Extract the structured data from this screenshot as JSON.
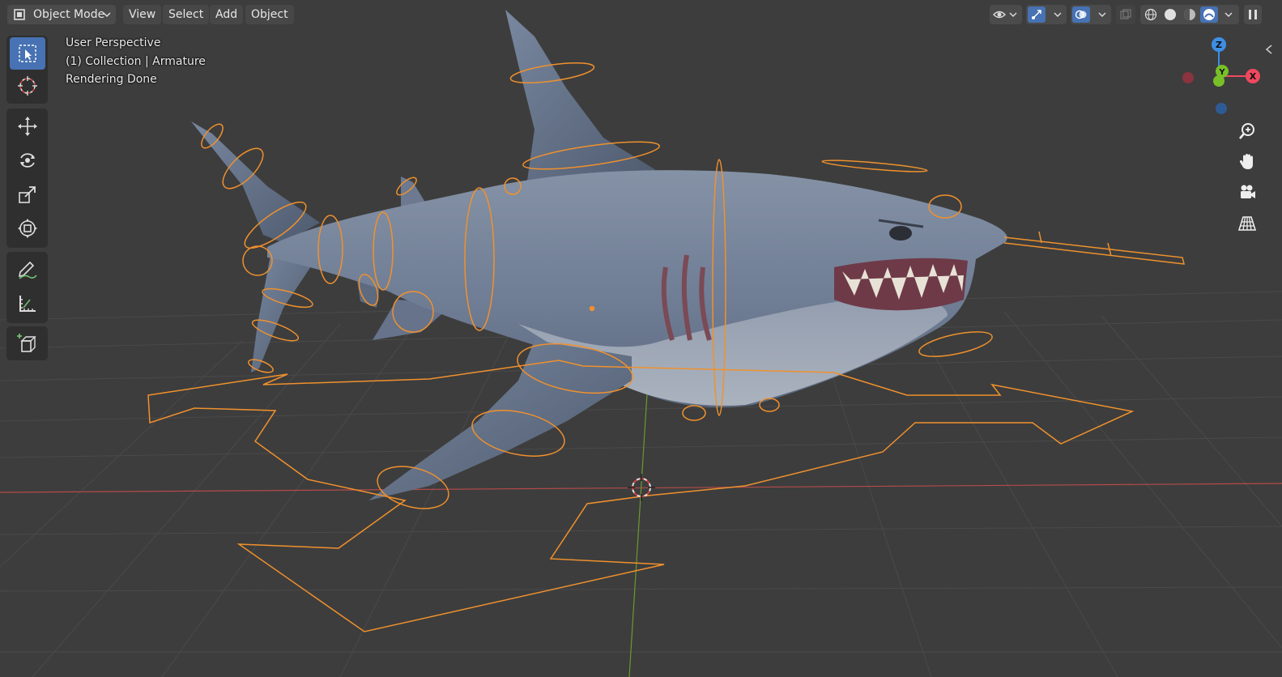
{
  "header": {
    "mode_label": "Object Mode",
    "menus": [
      "View",
      "Select",
      "Add",
      "Object"
    ]
  },
  "overlay": {
    "view_name": "User Perspective",
    "collection_info": "(1) Collection | Armature",
    "status": "Rendering Done"
  },
  "gizmo": {
    "axes": [
      "Z",
      "Y",
      "X"
    ],
    "colors": {
      "x": "#f0485f",
      "y": "#78c028",
      "z": "#3d8fe5"
    }
  },
  "toolbar": {
    "tools": [
      "select-box",
      "cursor",
      "move",
      "rotate",
      "scale",
      "transform",
      "annotate",
      "measure",
      "add-cube"
    ],
    "active_tool": "select-box"
  },
  "navigation": [
    "zoom",
    "pan",
    "camera-view",
    "perspective-toggle"
  ],
  "colors": {
    "accent": "#4772b3",
    "armature": "#f0912d",
    "background": "#3d3d3d",
    "x_axis_line": "#b54a4a",
    "y_axis_line": "#6b9a2f"
  }
}
